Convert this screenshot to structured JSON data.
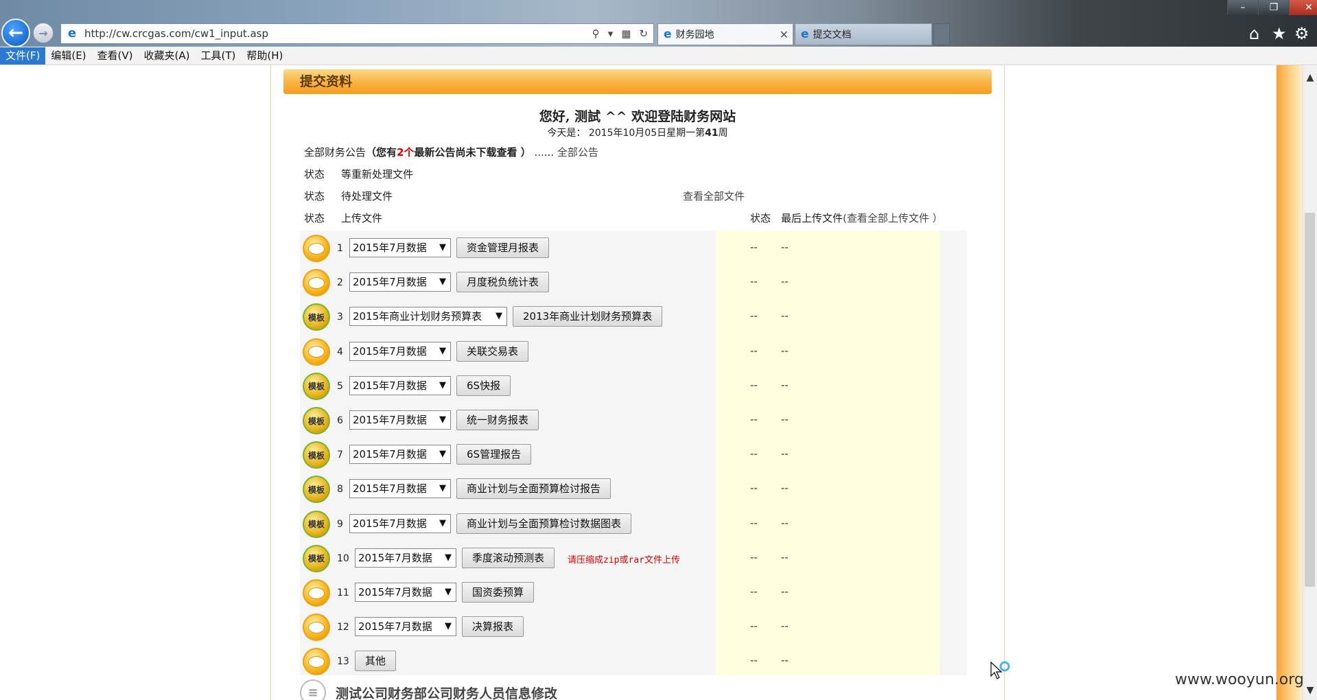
{
  "browser": {
    "url": "http://cw.crcgas.com/cw1_input.asp",
    "tabs": [
      {
        "title": "财务园地",
        "active": true
      },
      {
        "title": "提交文档",
        "active": false
      }
    ]
  },
  "menu": [
    "文件(F)",
    "编辑(E)",
    "查看(V)",
    "收藏夹(A)",
    "工具(T)",
    "帮助(H)"
  ],
  "page": {
    "header": "提交资料",
    "greeting": "您好, 测試 ^^ 欢迎登陆财务网站",
    "today_label": "今天是：",
    "today_date": "2015年10月05日星期一第",
    "today_week": "41",
    "today_suffix": "周",
    "notice_prefix": "全部财务公告",
    "notice_bold_open": "（您有",
    "notice_count": "2个",
    "notice_bold_close": "最新公告尚未下载查看 ）",
    "notice_dots": "......",
    "notice_link": "全部公告",
    "status_label": "状态",
    "status_rows": [
      {
        "label": "状态",
        "text": "等重新处理文件"
      },
      {
        "label": "状态",
        "text": "待处理文件",
        "link": "查看全部文件"
      }
    ],
    "upload_header": {
      "col1": "状态",
      "col2": "上传文件",
      "col3": "状态",
      "col4": "最后上传文件",
      "col4_link": "(查看全部上传文件 ）"
    },
    "rows": [
      {
        "num": "1",
        "icon": "comment",
        "period": "2015年7月数据",
        "button": "资金管理月报表",
        "status": "--",
        "last": "--"
      },
      {
        "num": "2",
        "icon": "comment",
        "period": "2015年7月数据",
        "button": "月度税负统计表",
        "status": "--",
        "last": "--"
      },
      {
        "num": "3",
        "icon": "template",
        "period": "2015年商业计划财务预算表",
        "button": "2013年商业计划财务预算表",
        "status": "--",
        "last": "--"
      },
      {
        "num": "4",
        "icon": "comment",
        "period": "2015年7月数据",
        "button": "关联交易表",
        "status": "--",
        "last": "--"
      },
      {
        "num": "5",
        "icon": "template",
        "period": "2015年7月数据",
        "button": "6S快报",
        "status": "--",
        "last": "--"
      },
      {
        "num": "6",
        "icon": "template",
        "period": "2015年7月数据",
        "button": "统一财务报表",
        "status": "--",
        "last": "--"
      },
      {
        "num": "7",
        "icon": "template",
        "period": "2015年7月数据",
        "button": "6S管理报告",
        "status": "--",
        "last": "--"
      },
      {
        "num": "8",
        "icon": "template",
        "period": "2015年7月数据",
        "button": "商业计划与全面预算检讨报告",
        "status": "--",
        "last": "--"
      },
      {
        "num": "9",
        "icon": "template",
        "period": "2015年7月数据",
        "button": "商业计划与全面预算检讨数据图表",
        "status": "--",
        "last": "--"
      },
      {
        "num": "10",
        "icon": "template",
        "period": "2015年7月数据",
        "button": "季度滚动预测表",
        "note": "请压缩成zip或rar文件上传",
        "status": "--",
        "last": "--"
      },
      {
        "num": "11",
        "icon": "comment",
        "period": "2015年7月数据",
        "button": "国资委预算",
        "status": "--",
        "last": "--"
      },
      {
        "num": "12",
        "icon": "comment",
        "period": "2015年7月数据",
        "button": "决算报表",
        "status": "--",
        "last": "--"
      },
      {
        "num": "13",
        "icon": "comment",
        "period": "",
        "button": "其他",
        "status": "--",
        "last": "--"
      }
    ],
    "template_badge_text": "模板",
    "footer_link": "测试公司财务部公司财务人员信息修改"
  },
  "watermark": "www.wooyun.org",
  "colors": {
    "header_bar": "#f9b23f",
    "accent_red": "#e00000",
    "yellow_column": "#ffffe0",
    "menu_active": "#2a7ad4"
  }
}
